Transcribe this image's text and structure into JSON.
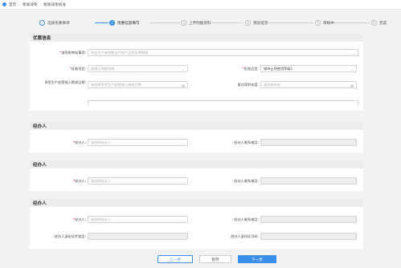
{
  "breadcrumb": {
    "home": "首页",
    "level2": "税收减免",
    "level3": "税收减免核准"
  },
  "steps": [
    {
      "num": "✓",
      "label": "选择优惠事项"
    },
    {
      "num": "2",
      "label": "优惠信息填写"
    },
    {
      "num": "3",
      "label": "上传附报资料"
    },
    {
      "num": "4",
      "label": "预览提交"
    },
    {
      "num": "5",
      "label": "审核中"
    },
    {
      "num": "6",
      "label": "完成"
    }
  ],
  "preferential": {
    "title": "优惠信息",
    "matter_label": "减免税审核事项:",
    "matter_placeholder": "农业生产者销售自产农产品免征增值税",
    "tax_type_label": "征收项目:",
    "tax_type_placeholder": "城镇土地使用税",
    "tax_item_label": "征收品目:",
    "tax_item_value": "城市土地使用等级1",
    "date_label": "享受生产经营收入期减日期:",
    "date_placeholder": "请选择享受生产经营收入期减日期",
    "year_label": "首次获利年度:",
    "year_placeholder": "请选择年份"
  },
  "agents": [
    {
      "title": "经办人",
      "name_label": "经办人:",
      "name_placeholder": "请选择经办人",
      "phone_label": "经办人联系电话:"
    },
    {
      "title": "经办人",
      "name_label": "经办人:",
      "name_placeholder": "请选择经办人",
      "phone_label": "经办人联系电话:"
    },
    {
      "title": "经办人",
      "name_label": "经办人:",
      "name_placeholder": "请选择经办人",
      "phone_label": "经办人联系电话:",
      "idtype_label": "经办人身份证件类型:",
      "idno_label": "经办人身份证号码:"
    }
  ],
  "footer": {
    "prev": "上一步",
    "save": "暂存",
    "next": "下一步"
  },
  "colors": {
    "accent": "#3b8ee8",
    "required": "#e33"
  }
}
